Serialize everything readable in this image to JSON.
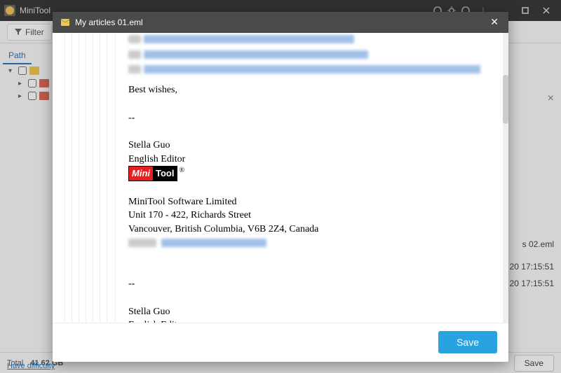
{
  "titlebar": {
    "title": "MiniTool"
  },
  "toolbar": {
    "filter_label": "Filter"
  },
  "sidebar": {
    "tab": "Path",
    "items": [
      {},
      {},
      {}
    ]
  },
  "partial_files": {
    "f1": "s 02.eml",
    "t1": "20 17:15:51",
    "t2": "20 17:15:51"
  },
  "footer": {
    "total_label": "Total",
    "total_value": "41.62 GB",
    "help_link": "Have difficulty",
    "save_label": "Save"
  },
  "modal": {
    "title": "My articles 01.eml",
    "save_label": "Save",
    "email": {
      "closing": "Best wishes,",
      "sep": "--",
      "name": "Stella Guo",
      "role": "English Editor",
      "logo_left": "Mini",
      "logo_right": "Tool",
      "company": "MiniTool Software Limited",
      "addr1": "Unit 170 - 422, Richards Street",
      "addr2": "Vancouver, British Columbia, V6B 2Z4, Canada",
      "email_label": "Email"
    }
  }
}
